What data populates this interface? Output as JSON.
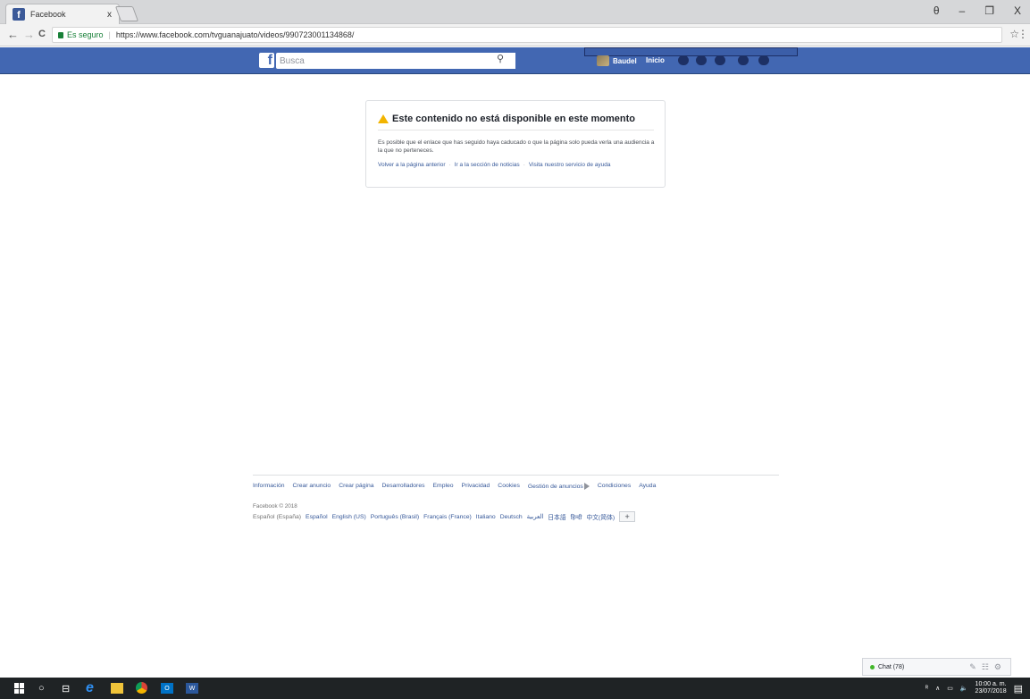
{
  "browser": {
    "tab_title": "Facebook",
    "tab_close": "x",
    "window_controls": [
      "θ",
      "–",
      "❐",
      "X"
    ],
    "back": "←",
    "forward": "→",
    "reload": "C",
    "secure_label": "Es seguro",
    "url": "https://www.facebook.com/tvguanajuato/videos/990723001134868/",
    "star": "☆",
    "menu": "⋮"
  },
  "fb_header": {
    "logo": "f",
    "search_placeholder": "Busca",
    "search_icon": "⚲",
    "user_name": "Baudel",
    "home_label": "Inicio"
  },
  "error": {
    "title": "Este contenido no está disponible en este momento",
    "description": "Es posible que el enlace que has seguido haya caducado o que la página solo pueda verla una audiencia a la que no perteneces.",
    "links": [
      "Volver a la página anterior",
      "Ir a la sección de noticias",
      "Visita nuestro servicio de ayuda"
    ],
    "separator": "·"
  },
  "footer": {
    "links": [
      "Información",
      "Crear anuncio",
      "Crear página",
      "Desarrolladores",
      "Empleo",
      "Privacidad",
      "Cookies",
      "Gestión de anuncios",
      "Condiciones",
      "Ayuda"
    ],
    "copyright": "Facebook © 2018",
    "current_language": "Español (España)",
    "languages": [
      "Español",
      "English (US)",
      "Português (Brasil)",
      "Français (France)",
      "Italiano",
      "Deutsch",
      "العربية",
      "日本語",
      "हिन्दी",
      "中文(简体)"
    ],
    "more": "+"
  },
  "chat": {
    "label": "Chat (78)",
    "icons": [
      "✎",
      "☷",
      "⚙"
    ]
  },
  "taskbar": {
    "time": "10:00 a. m.",
    "date": "23/07/2018",
    "tray_icons": [
      "ᴿ",
      "∧",
      "▭",
      "🔈"
    ]
  }
}
